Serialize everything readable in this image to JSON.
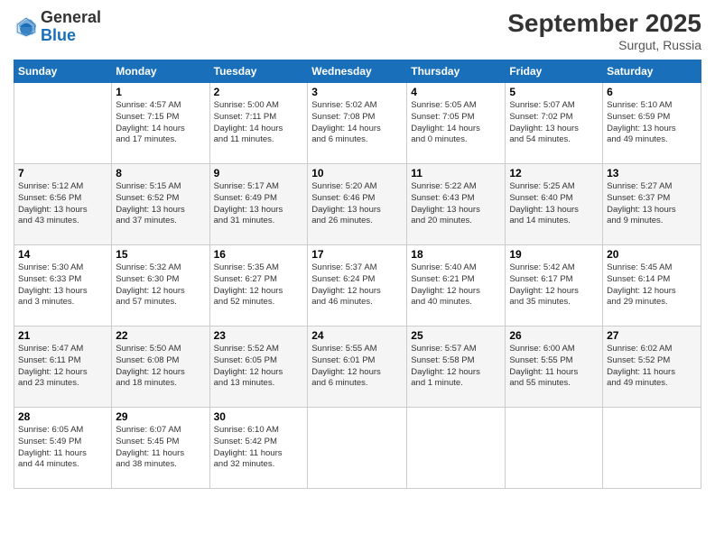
{
  "logo": {
    "general": "General",
    "blue": "Blue"
  },
  "header": {
    "month": "September 2025",
    "location": "Surgut, Russia"
  },
  "weekdays": [
    "Sunday",
    "Monday",
    "Tuesday",
    "Wednesday",
    "Thursday",
    "Friday",
    "Saturday"
  ],
  "weeks": [
    [
      {
        "day": "",
        "info": ""
      },
      {
        "day": "1",
        "info": "Sunrise: 4:57 AM\nSunset: 7:15 PM\nDaylight: 14 hours\nand 17 minutes."
      },
      {
        "day": "2",
        "info": "Sunrise: 5:00 AM\nSunset: 7:11 PM\nDaylight: 14 hours\nand 11 minutes."
      },
      {
        "day": "3",
        "info": "Sunrise: 5:02 AM\nSunset: 7:08 PM\nDaylight: 14 hours\nand 6 minutes."
      },
      {
        "day": "4",
        "info": "Sunrise: 5:05 AM\nSunset: 7:05 PM\nDaylight: 14 hours\nand 0 minutes."
      },
      {
        "day": "5",
        "info": "Sunrise: 5:07 AM\nSunset: 7:02 PM\nDaylight: 13 hours\nand 54 minutes."
      },
      {
        "day": "6",
        "info": "Sunrise: 5:10 AM\nSunset: 6:59 PM\nDaylight: 13 hours\nand 49 minutes."
      }
    ],
    [
      {
        "day": "7",
        "info": "Sunrise: 5:12 AM\nSunset: 6:56 PM\nDaylight: 13 hours\nand 43 minutes."
      },
      {
        "day": "8",
        "info": "Sunrise: 5:15 AM\nSunset: 6:52 PM\nDaylight: 13 hours\nand 37 minutes."
      },
      {
        "day": "9",
        "info": "Sunrise: 5:17 AM\nSunset: 6:49 PM\nDaylight: 13 hours\nand 31 minutes."
      },
      {
        "day": "10",
        "info": "Sunrise: 5:20 AM\nSunset: 6:46 PM\nDaylight: 13 hours\nand 26 minutes."
      },
      {
        "day": "11",
        "info": "Sunrise: 5:22 AM\nSunset: 6:43 PM\nDaylight: 13 hours\nand 20 minutes."
      },
      {
        "day": "12",
        "info": "Sunrise: 5:25 AM\nSunset: 6:40 PM\nDaylight: 13 hours\nand 14 minutes."
      },
      {
        "day": "13",
        "info": "Sunrise: 5:27 AM\nSunset: 6:37 PM\nDaylight: 13 hours\nand 9 minutes."
      }
    ],
    [
      {
        "day": "14",
        "info": "Sunrise: 5:30 AM\nSunset: 6:33 PM\nDaylight: 13 hours\nand 3 minutes."
      },
      {
        "day": "15",
        "info": "Sunrise: 5:32 AM\nSunset: 6:30 PM\nDaylight: 12 hours\nand 57 minutes."
      },
      {
        "day": "16",
        "info": "Sunrise: 5:35 AM\nSunset: 6:27 PM\nDaylight: 12 hours\nand 52 minutes."
      },
      {
        "day": "17",
        "info": "Sunrise: 5:37 AM\nSunset: 6:24 PM\nDaylight: 12 hours\nand 46 minutes."
      },
      {
        "day": "18",
        "info": "Sunrise: 5:40 AM\nSunset: 6:21 PM\nDaylight: 12 hours\nand 40 minutes."
      },
      {
        "day": "19",
        "info": "Sunrise: 5:42 AM\nSunset: 6:17 PM\nDaylight: 12 hours\nand 35 minutes."
      },
      {
        "day": "20",
        "info": "Sunrise: 5:45 AM\nSunset: 6:14 PM\nDaylight: 12 hours\nand 29 minutes."
      }
    ],
    [
      {
        "day": "21",
        "info": "Sunrise: 5:47 AM\nSunset: 6:11 PM\nDaylight: 12 hours\nand 23 minutes."
      },
      {
        "day": "22",
        "info": "Sunrise: 5:50 AM\nSunset: 6:08 PM\nDaylight: 12 hours\nand 18 minutes."
      },
      {
        "day": "23",
        "info": "Sunrise: 5:52 AM\nSunset: 6:05 PM\nDaylight: 12 hours\nand 13 minutes."
      },
      {
        "day": "24",
        "info": "Sunrise: 5:55 AM\nSunset: 6:01 PM\nDaylight: 12 hours\nand 6 minutes."
      },
      {
        "day": "25",
        "info": "Sunrise: 5:57 AM\nSunset: 5:58 PM\nDaylight: 12 hours\nand 1 minute."
      },
      {
        "day": "26",
        "info": "Sunrise: 6:00 AM\nSunset: 5:55 PM\nDaylight: 11 hours\nand 55 minutes."
      },
      {
        "day": "27",
        "info": "Sunrise: 6:02 AM\nSunset: 5:52 PM\nDaylight: 11 hours\nand 49 minutes."
      }
    ],
    [
      {
        "day": "28",
        "info": "Sunrise: 6:05 AM\nSunset: 5:49 PM\nDaylight: 11 hours\nand 44 minutes."
      },
      {
        "day": "29",
        "info": "Sunrise: 6:07 AM\nSunset: 5:45 PM\nDaylight: 11 hours\nand 38 minutes."
      },
      {
        "day": "30",
        "info": "Sunrise: 6:10 AM\nSunset: 5:42 PM\nDaylight: 11 hours\nand 32 minutes."
      },
      {
        "day": "",
        "info": ""
      },
      {
        "day": "",
        "info": ""
      },
      {
        "day": "",
        "info": ""
      },
      {
        "day": "",
        "info": ""
      }
    ]
  ]
}
